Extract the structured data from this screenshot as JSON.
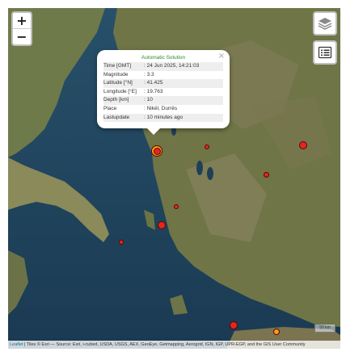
{
  "zoom": {
    "in_label": "+",
    "out_label": "−"
  },
  "icons": {
    "layers": "layers-icon",
    "list": "list-icon",
    "close": "close-icon"
  },
  "popup": {
    "title": "Automatic Solution",
    "close_label": "×",
    "rows": [
      {
        "key": "Time [GMT]",
        "value": ": 24 Jun 2025, 14:21:03"
      },
      {
        "key": "Magnitude",
        "value": ": 3.3"
      },
      {
        "key": "Latitude [°N]",
        "value": ": 41.425"
      },
      {
        "key": "Longitude [°E]",
        "value": ": 19.763"
      },
      {
        "key": "Depth [km]",
        "value": ": 10"
      },
      {
        "key": "Place",
        "value": ": Nikël, Durrës"
      },
      {
        "key": "Lastupdate",
        "value": ": 10 minutes ago"
      }
    ]
  },
  "attribution": {
    "link": "Leaflet",
    "text": " | Tiles © Esri — Source: Esri, i-cubed, USDA, USGS, AEX, GeoEye, Getmapping, Aerogrid, IGN, IGP, UPR-EGP, and the GIS User Community"
  },
  "scale_label": "50 km",
  "colors": {
    "quake_red": "#e0281e",
    "quake_orange": "#f0a020",
    "popup_title": "#2e8b2e"
  }
}
